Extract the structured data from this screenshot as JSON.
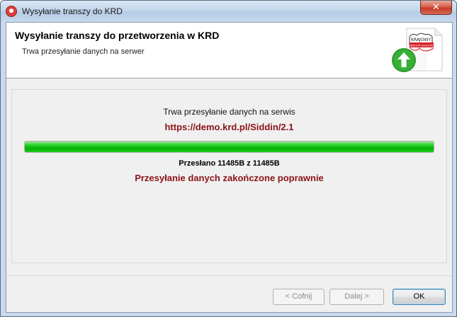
{
  "window": {
    "title": "Wysyłanie transzy do KRD",
    "close_label": "✕"
  },
  "header": {
    "title": "Wysyłanie transzy do przetworzenia w KRD",
    "subtitle": "Trwa przesyłanie danych na serwer",
    "logo_text_top": "KRAJOWY",
    "logo_text_band": "REJESTR DŁUGÓW",
    "logo_icon": "upload-arrow-icon"
  },
  "content": {
    "status": "Trwa przesyłanie danych na serwis",
    "url": "https://demo.krd.pl/Siddin/2.1",
    "progress_fraction": 1.0,
    "transferred": "Przesłano 11485B z 11485B",
    "result": "Przesyłanie danych zakończone poprawnie"
  },
  "buttons": {
    "back": "< Cofnij",
    "next": "Dalej >",
    "ok": "OK"
  },
  "colors": {
    "accent_text": "#8b1218",
    "progress_green": "#06b006",
    "logo_red": "#d8232a"
  }
}
